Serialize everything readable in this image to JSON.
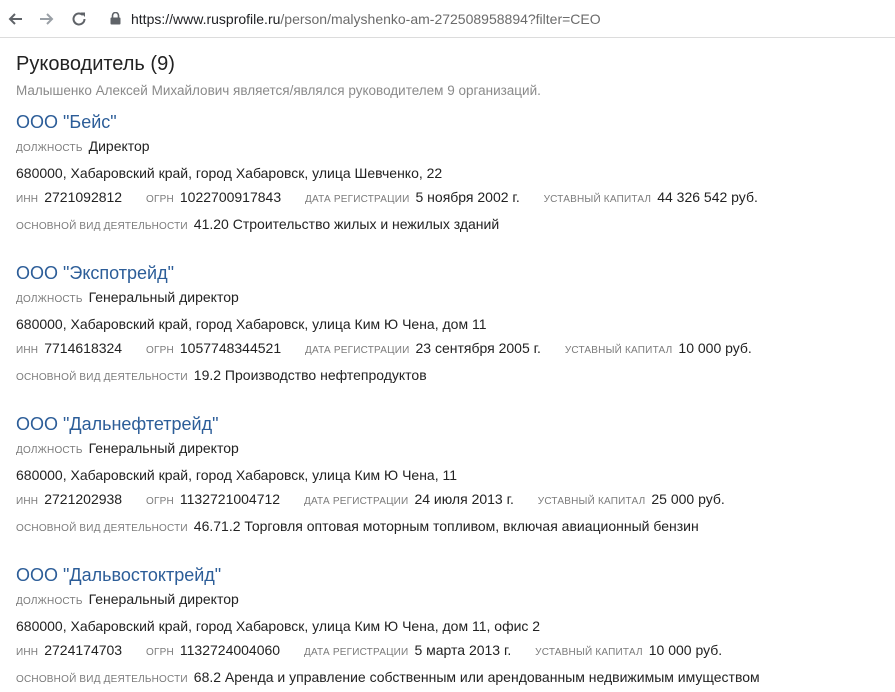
{
  "browser": {
    "url_host": "https://www.rusprofile.ru",
    "url_path": "/person/malyshenko-am-272508958894?filter=CEO"
  },
  "page": {
    "heading": "Руководитель (9)",
    "subtitle": "Малышенко Алексей Михайлович является/являлся руководителем 9 организаций."
  },
  "labels": {
    "position": "должность",
    "inn": "инн",
    "ogrn": "огрн",
    "reg_date": "дата регистрации",
    "capital": "уставный капитал",
    "activity": "основной вид деятельности"
  },
  "organizations": [
    {
      "name": "ООО \"Бейс\"",
      "position": "Директор",
      "address": "680000, Хабаровский край, город Хабаровск, улица Шевченко, 22",
      "inn": "2721092812",
      "ogrn": "1022700917843",
      "reg_date": "5 ноября 2002 г.",
      "capital": "44 326 542 руб.",
      "activity": "41.20 Строительство жилых и нежилых зданий"
    },
    {
      "name": "ООО \"Экспотрейд\"",
      "position": "Генеральный директор",
      "address": "680000, Хабаровский край, город Хабаровск, улица Ким Ю Чена, дом 11",
      "inn": "7714618324",
      "ogrn": "1057748344521",
      "reg_date": "23 сентября 2005 г.",
      "capital": "10 000 руб.",
      "activity": "19.2 Производство нефтепродуктов"
    },
    {
      "name": "ООО \"Дальнефтетрейд\"",
      "position": "Генеральный директор",
      "address": "680000, Хабаровский край, город Хабаровск, улица Ким Ю Чена, 11",
      "inn": "2721202938",
      "ogrn": "1132721004712",
      "reg_date": "24 июля 2013 г.",
      "capital": "25 000 руб.",
      "activity": "46.71.2 Торговля оптовая моторным топливом, включая авиационный бензин"
    },
    {
      "name": "ООО \"Дальвостоктрейд\"",
      "position": "Генеральный директор",
      "address": "680000, Хабаровский край, город Хабаровск, улица Ким Ю Чена, дом 11, офис 2",
      "inn": "2724174703",
      "ogrn": "1132724004060",
      "reg_date": "5 марта 2013 г.",
      "capital": "10 000 руб.",
      "activity": "68.2 Аренда и управление собственным или арендованным недвижимым имуществом"
    }
  ]
}
